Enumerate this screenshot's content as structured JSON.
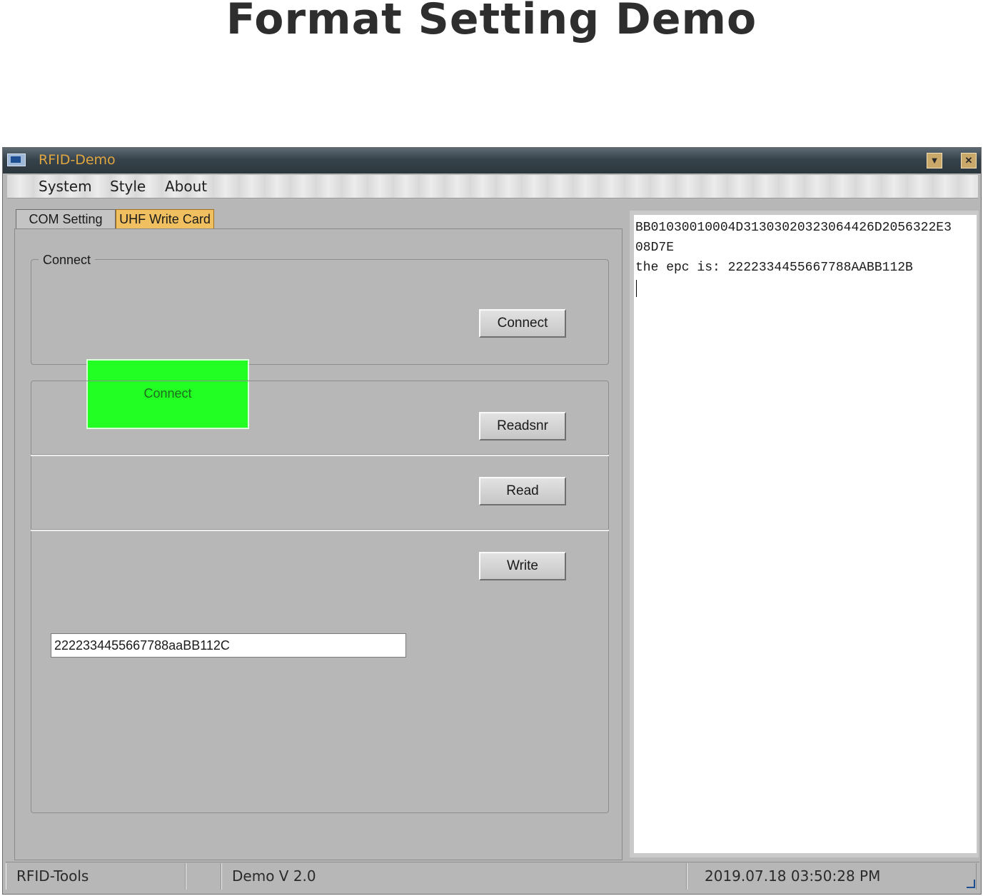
{
  "page": {
    "title": "Format Setting Demo"
  },
  "window": {
    "title": "RFID-Demo",
    "buttons": {
      "minimize": "▼",
      "close": "✕"
    },
    "icon": "app-icon"
  },
  "menu": {
    "items": [
      "System",
      "Style",
      "About"
    ]
  },
  "tabs": [
    {
      "label": "COM Setting",
      "active": false
    },
    {
      "label": "UHF Write Card",
      "active": true
    }
  ],
  "connect_group": {
    "legend": "Connect",
    "status_label": "Connect",
    "status_color": "#22ff22",
    "button_label": "Connect"
  },
  "buttons": {
    "readsnr": "Readsnr",
    "read": "Read",
    "write": "Write"
  },
  "epc_input": {
    "value": "2222334455667788aaBB112C"
  },
  "log": {
    "lines": [
      "BB01030010004D31303020323064426D2056322E3",
      "08D7E",
      "the epc is: 2222334455667788AABB112B"
    ]
  },
  "statusbar": {
    "left": "RFID-Tools",
    "middle": "Demo  V 2.0",
    "right": "2019.07.18   03:50:28 PM"
  }
}
